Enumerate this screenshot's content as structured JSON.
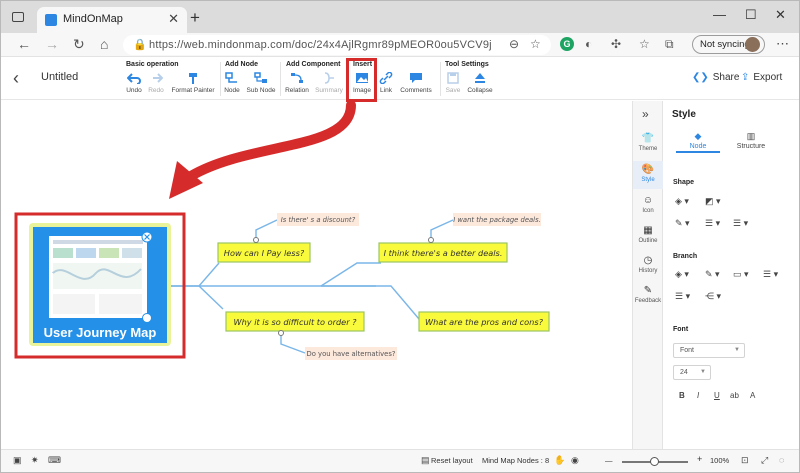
{
  "browser": {
    "tab_title": "MindOnMap",
    "tab_close": "✕",
    "new_tab": "+",
    "url": "https://web.mindonmap.com/doc/24x4AjlRgmr89pMEOR0ou5VCV9j",
    "sync_label": "Not syncing",
    "win_min": "—",
    "win_max": "☐",
    "win_close": "✕"
  },
  "app": {
    "doc_title": "Untitled",
    "groups": {
      "basic": "Basic operation",
      "add_node": "Add Node",
      "add_component": "Add Component",
      "insert": "Insert",
      "tool_settings": "Tool Settings"
    },
    "buttons": {
      "undo": "Undo",
      "redo": "Redo",
      "format_painter": "Format Painter",
      "node": "Node",
      "sub_node": "Sub Node",
      "relation": "Relation",
      "summary": "Summary",
      "image": "Image",
      "link": "Link",
      "comments": "Comments",
      "save": "Save",
      "collapse": "Collapse"
    },
    "share_label": "Share",
    "export_label": "Export"
  },
  "mindmap": {
    "root_label": "User Journey Map",
    "nodes": {
      "pay_less": "How can I Pay less?",
      "better_deals": "I think there's a better deals.",
      "difficult_order": "Why it is so difficult to  order ?",
      "pros_cons": "What are the pros and cons?"
    },
    "notes": {
      "discount": "Is there' s a discount?",
      "package": "I want the package deals.",
      "alternatives": "Do you have alternatives?"
    }
  },
  "rail": {
    "theme": "Theme",
    "style": "Style",
    "icon": "Icon",
    "outline": "Outline",
    "history": "History",
    "feedback": "Feedback"
  },
  "panel": {
    "title": "Style",
    "tab_node": "Node",
    "tab_structure": "Structure",
    "shape_title": "Shape",
    "branch_title": "Branch",
    "font_title": "Font",
    "font_value": "Font",
    "font_size": "24",
    "bold": "B",
    "italic": "I",
    "underline": "U",
    "strike": "ab",
    "aa": "A"
  },
  "status": {
    "reset_layout": "Reset layout",
    "nodes_label": "Mind Map Nodes : 8",
    "zoom": "100%",
    "zoom_minus": "—",
    "zoom_plus": "+"
  },
  "colors": {
    "accent": "#2d87e2",
    "highlight": "#d62b2b",
    "node_fill": "#fafa3c",
    "node_border": "#99c463",
    "note_fill": "#fde8dc",
    "root_fill": "#2490e8"
  }
}
